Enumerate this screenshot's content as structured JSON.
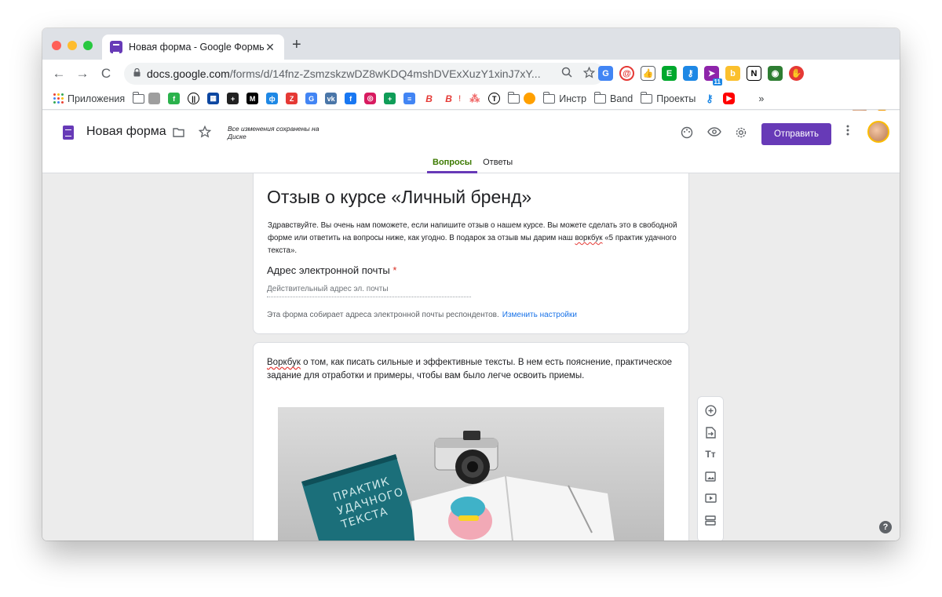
{
  "browser": {
    "tab_title": "Новая форма - Google Формы",
    "tab_close": "✕",
    "new_tab": "+",
    "url_host": "docs.google.com",
    "url_path": "/forms/d/14fnz-ZsmzskzwDZ8wKDQ4mshDVExXuzY1xinJ7xY...",
    "back": "←",
    "forward": "→",
    "reload": "C",
    "update_badge": "!"
  },
  "bookmarks": {
    "apps_label": "Приложения",
    "instr_label": "Инстр",
    "band_label": "Band",
    "projects_label": "Проекты",
    "more": "»",
    "exclamation": "!"
  },
  "forms": {
    "form_name": "Новая форма",
    "saved_note": "Все изменения сохранены на Диске",
    "send_label": "Отправить",
    "tab_questions": "Вопросы",
    "tab_answers": "Ответы"
  },
  "card1": {
    "title": "Отзыв о курсе «Личный бренд»",
    "desc_part1": "Здравствуйте. Вы очень нам поможете, если напишите отзыв о нашем курсе. Вы можете сделать это в свободной форме или ответить на вопросы ниже, как угодно. В подарок за отзыв мы дарим наш ",
    "desc_word": "воркбук",
    "desc_part2": " «5 практик удачного текста».",
    "question_label": "Адрес электронной почты",
    "required_mark": "*",
    "input_placeholder": "Действительный адрес эл. почты",
    "email_note": "Эта форма собирает адреса электронной почты респондентов.",
    "email_link": "Изменить настройки"
  },
  "card2": {
    "text_word": "Воркбук",
    "text_rest": " о том, как писать сильные и эффективные тексты. В нем есть пояснение, практическое задание для отработки и примеры, чтобы вам было легче освоить приемы.",
    "book_text": "ПРАКТИК УДАЧНОГО ТЕКСТА"
  },
  "side_toolbar": {
    "tt_glyph": "Tт"
  },
  "colors": {
    "accent": "#673ab7",
    "tab_active": "#3c7a00",
    "link": "#1a73e8",
    "required": "#d93025"
  }
}
